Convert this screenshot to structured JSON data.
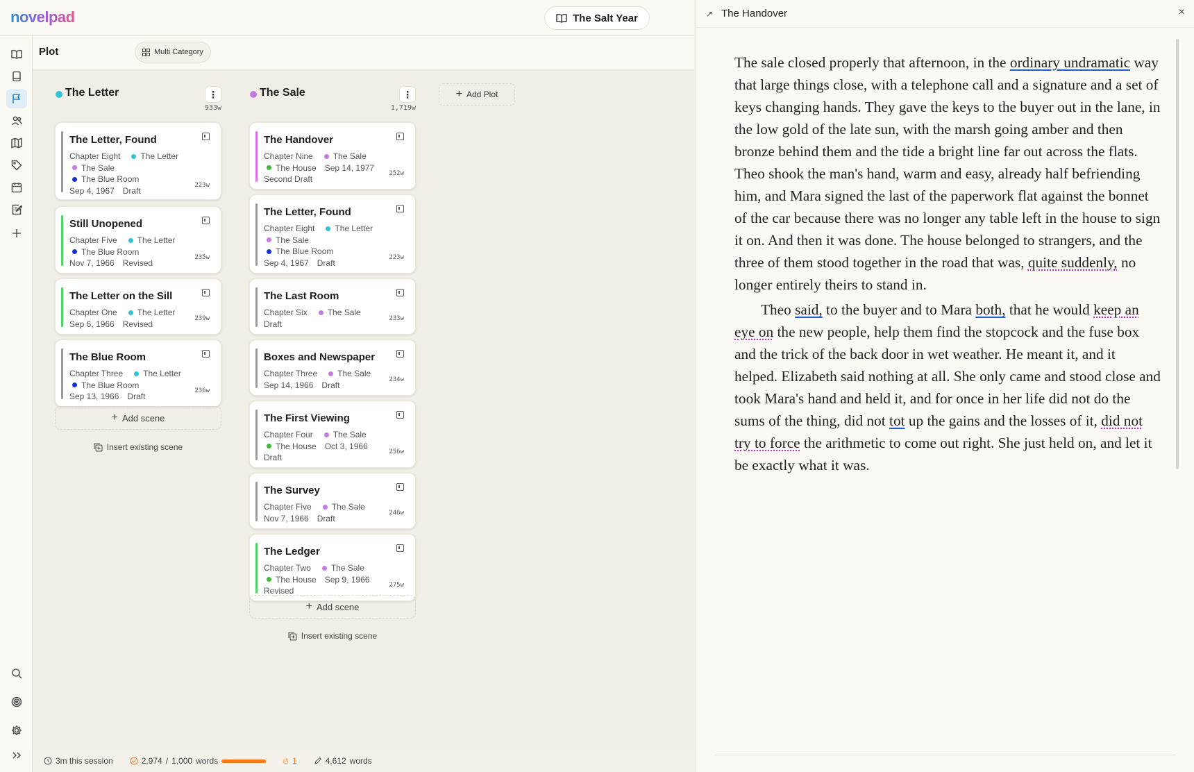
{
  "app": {
    "logo": "novelpad",
    "project_title": "The Salt Year"
  },
  "plot": {
    "title": "Plot",
    "multi_category_label": "Multi Category",
    "add_plot_label": "Add Plot"
  },
  "columns": [
    {
      "name": "The Letter",
      "color": "#2ec4d6",
      "word_count": "933w",
      "add_scene": "Add scene",
      "insert_scene": "Insert existing scene",
      "cards": [
        {
          "title": "The Letter, Found",
          "bar": "#9a9a9a",
          "lines": [
            [
              "Chapter Eight",
              "The Letter"
            ],
            [
              "The Sale"
            ],
            [
              "The Blue Room"
            ],
            [
              "Sep 4, 1967",
              "Draft"
            ]
          ],
          "dots": [
            [
              null,
              "#2ec4d6"
            ],
            [
              "#c67be0"
            ],
            [
              "#1b2fd6"
            ],
            [
              null,
              null
            ]
          ],
          "wc": "223w"
        },
        {
          "title": "Still Unopened",
          "bar": "#4fd36a",
          "lines": [
            [
              "Chapter Five",
              "The Letter"
            ],
            [
              "The Blue Room"
            ],
            [
              "Nov 7, 1966",
              "Revised"
            ]
          ],
          "dots": [
            [
              null,
              "#2ec4d6"
            ],
            [
              "#1b2fd6"
            ],
            [
              null,
              null
            ]
          ],
          "wc": "235w"
        },
        {
          "title": "The Letter on the Sill",
          "bar": "#4fd36a",
          "lines": [
            [
              "Chapter One",
              "The Letter"
            ],
            [
              "Sep 6, 1966",
              "Revised"
            ]
          ],
          "dots": [
            [
              null,
              "#2ec4d6"
            ],
            [
              null,
              null
            ]
          ],
          "wc": "239w"
        },
        {
          "title": "The Blue Room",
          "bar": "#9a9a9a",
          "lines": [
            [
              "Chapter Three",
              "The Letter"
            ],
            [
              "The Blue Room"
            ],
            [
              "Sep 13, 1966",
              "Draft"
            ]
          ],
          "dots": [
            [
              null,
              "#2ec4d6"
            ],
            [
              "#1b2fd6"
            ],
            [
              null,
              null
            ]
          ],
          "wc": "236w"
        }
      ]
    },
    {
      "name": "The Sale",
      "color": "#c67be0",
      "word_count": "1,719w",
      "add_scene": "Add scene",
      "insert_scene": "Insert existing scene",
      "cards": [
        {
          "title": "The Handover",
          "bar": "#e06fe3",
          "lines": [
            [
              "Chapter Nine",
              "The Sale"
            ],
            [
              "The House",
              "Sep 14, 1977"
            ],
            [
              "Second Draft"
            ]
          ],
          "dots": [
            [
              null,
              "#c67be0"
            ],
            [
              "#3dbb3d",
              null
            ],
            [
              null
            ]
          ],
          "wc": "252w"
        },
        {
          "title": "The Letter, Found",
          "bar": "#9a9a9a",
          "lines": [
            [
              "Chapter Eight",
              "The Letter"
            ],
            [
              "The Sale"
            ],
            [
              "The Blue Room"
            ],
            [
              "Sep 4, 1967",
              "Draft"
            ]
          ],
          "dots": [
            [
              null,
              "#2ec4d6"
            ],
            [
              "#c67be0"
            ],
            [
              "#1b2fd6"
            ],
            [
              null,
              null
            ]
          ],
          "wc": "223w"
        },
        {
          "title": "The Last Room",
          "bar": "#9a9a9a",
          "lines": [
            [
              "Chapter Six",
              "The Sale"
            ],
            [
              "Draft"
            ]
          ],
          "dots": [
            [
              null,
              "#c67be0"
            ],
            [
              null
            ]
          ],
          "wc": "233w"
        },
        {
          "title": "Boxes and Newspaper",
          "bar": "#9a9a9a",
          "lines": [
            [
              "Chapter Three",
              "The Sale"
            ],
            [
              "Sep 14, 1966",
              "Draft"
            ]
          ],
          "dots": [
            [
              null,
              "#c67be0"
            ],
            [
              null,
              null
            ]
          ],
          "wc": "234w"
        },
        {
          "title": "The First Viewing",
          "bar": "#9a9a9a",
          "lines": [
            [
              "Chapter Four",
              "The Sale"
            ],
            [
              "The House",
              "Oct 3, 1966"
            ],
            [
              "Draft"
            ]
          ],
          "dots": [
            [
              null,
              "#c67be0"
            ],
            [
              "#3dbb3d",
              null
            ],
            [
              null
            ]
          ],
          "wc": "256w"
        },
        {
          "title": "The Survey",
          "bar": "#9a9a9a",
          "lines": [
            [
              "Chapter Five",
              "The Sale"
            ],
            [
              "Nov 7, 1966",
              "Draft"
            ]
          ],
          "dots": [
            [
              null,
              "#c67be0"
            ],
            [
              null,
              null
            ]
          ],
          "wc": "246w"
        },
        {
          "title": "The Ledger",
          "bar": "#4fd36a",
          "lines": [
            [
              "Chapter Two",
              "The Sale"
            ],
            [
              "The House",
              "Sep 9, 1966"
            ],
            [
              "Revised"
            ]
          ],
          "dots": [
            [
              null,
              "#c67be0"
            ],
            [
              "#3dbb3d",
              null
            ],
            [
              null
            ]
          ],
          "wc": "275w"
        }
      ]
    }
  ],
  "status": {
    "session": "3m this session",
    "goal_current": "2,974",
    "goal_sep": "/",
    "goal_target": "1,000",
    "goal_unit": "words",
    "goal_progress": 1.0,
    "streak": "1",
    "total_words": "4,612",
    "total_unit": "words"
  },
  "panel": {
    "title": "The Handover",
    "paragraphs": [
      [
        [
          "The sale closed properly that afternoon, in the ",
          ""
        ],
        [
          "ordinary undramatic",
          "u-blue"
        ],
        [
          " way that large things close, with a telephone call and a signature and a set of keys changing hands. They gave the keys to the buyer out in the lane, in the low gold of the late sun, with the marsh going amber and then bronze behind them and the tide a bright line far out across the flats. Theo shook the man's hand, warm and easy, already half befriending him, and Mara signed the last of the paperwork flat against the bonnet of the car because there was no longer any table left in the house to sign it on. And then it was done. The house belonged to strangers, and the three of them stood together in the road that was, ",
          ""
        ],
        [
          "quite suddenly,",
          "u-purple"
        ],
        [
          " no longer entirely theirs to stand in.",
          ""
        ]
      ],
      [
        [
          "Theo ",
          ""
        ],
        [
          "said,",
          "u-blue"
        ],
        [
          " to the buyer and to Mara ",
          ""
        ],
        [
          "both,",
          "u-blue"
        ],
        [
          " that he would ",
          ""
        ],
        [
          "keep an eye on",
          "u-purple"
        ],
        [
          " the new people, help them find the stopcock and the fuse box and the trick of the back door in wet weather. He meant it, and it helped. Elizabeth said nothing at all. She only came and stood close and took Mara's hand and held it, and for once in her life did not do the sums of the thing, did not ",
          ""
        ],
        [
          "tot",
          "u-blue"
        ],
        [
          " up the gains and the losses of it, ",
          ""
        ],
        [
          "did not try to force",
          "u-purple"
        ],
        [
          " the arithmetic to come out right. She just held on, and let it be exactly what it was.",
          ""
        ]
      ]
    ]
  }
}
